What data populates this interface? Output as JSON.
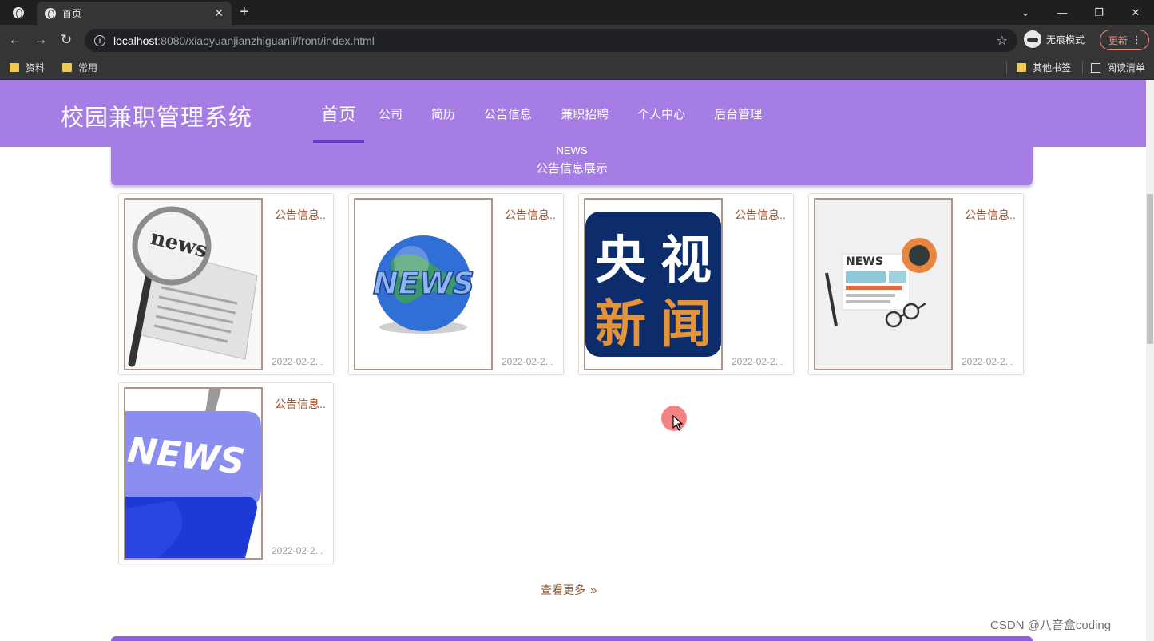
{
  "browser": {
    "tab_title": "首页",
    "url_host": "localhost",
    "url_rest": ":8080/xiaoyuanjianzhiguanli/front/index.html",
    "incognito_label": "无痕模式",
    "update_label": "更新",
    "bookmarks": [
      "资料",
      "常用"
    ],
    "bookmarks_right": [
      "其他书签",
      "阅读清单"
    ]
  },
  "site": {
    "logo": "校园兼职管理系统",
    "nav": [
      "首页",
      "公司",
      "简历",
      "公告信息",
      "兼职招聘",
      "个人中心",
      "后台管理"
    ],
    "active_nav": "首页"
  },
  "banner": {
    "en": "NEWS",
    "cn": "公告信息展示"
  },
  "cards": [
    {
      "title": "公告信息..",
      "date": "2022-02-2...",
      "image": "magnifier-newspaper"
    },
    {
      "title": "公告信息..",
      "date": "2022-02-2...",
      "image": "globe-news"
    },
    {
      "title": "公告信息..",
      "date": "2022-02-2...",
      "image": "cctv-news"
    },
    {
      "title": "公告信息..",
      "date": "2022-02-2...",
      "image": "flat-newspaper"
    },
    {
      "title": "公告信息..",
      "date": "2022-02-2...",
      "image": "news-key"
    }
  ],
  "more_link": "查看更多",
  "watermark": "CSDN @八音盒coding"
}
